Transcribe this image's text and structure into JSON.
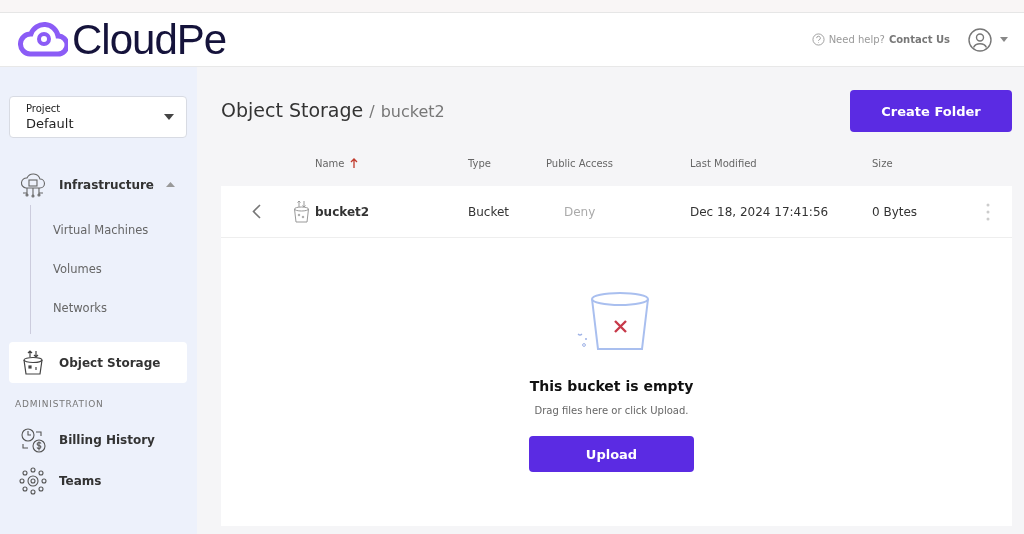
{
  "header": {
    "logo": "CloudPe",
    "help_prefix": "Need help?",
    "help_link": "Contact Us"
  },
  "sidebar": {
    "project": {
      "label": "Project",
      "value": "Default"
    },
    "nav": [
      {
        "label": "Infrastructure",
        "expanded": true,
        "selected": false,
        "children": [
          {
            "label": "Virtual Machines"
          },
          {
            "label": "Volumes"
          },
          {
            "label": "Networks"
          }
        ]
      },
      {
        "label": "Object Storage",
        "selected": true
      }
    ],
    "section": "ADMINISTRATION",
    "admin": [
      {
        "label": "Billing History",
        "selected": false
      },
      {
        "label": "Teams",
        "selected": false
      }
    ]
  },
  "main": {
    "breadcrumb": {
      "root": "Object Storage",
      "separator": "/",
      "current": "bucket2"
    },
    "create_button": "Create Folder",
    "table": {
      "columns": [
        {
          "label": "Name",
          "sorted": true
        },
        {
          "label": "Type",
          "sorted": false
        },
        {
          "label": "Public Access",
          "sorted": false
        },
        {
          "label": "Last Modified",
          "sorted": false
        },
        {
          "label": "Size",
          "sorted": false
        }
      ],
      "rows": [
        {
          "name": "bucket2",
          "type": "Bucket",
          "public_access": "Deny",
          "public_access_enabled": false,
          "last_modified": "Dec 18, 2024 17:41:56",
          "size": "0 Bytes"
        }
      ]
    },
    "empty": {
      "title": "This bucket is empty",
      "hint": "Drag files here or click Upload.",
      "button": "Upload"
    }
  }
}
